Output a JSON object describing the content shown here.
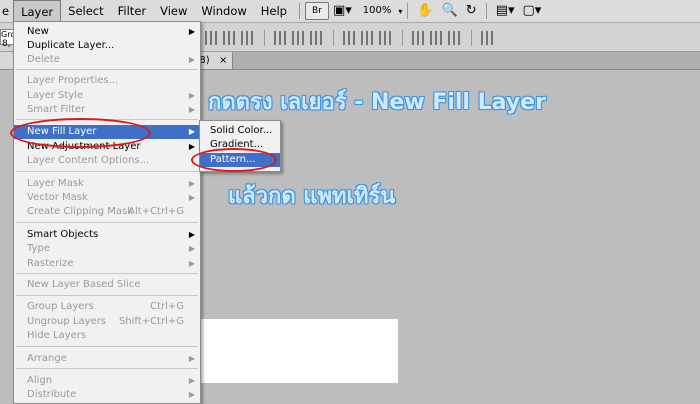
{
  "menubar": {
    "items": [
      "Layer",
      "Select",
      "Filter",
      "View",
      "Window",
      "Help"
    ],
    "br_label": "Br",
    "zoom": "100%",
    "left_clip": "e"
  },
  "options_bar": {
    "field_text": "Groo"
  },
  "document_tab": {
    "left_text": "8, 1",
    "suffix": "/8)",
    "close": "×"
  },
  "layer_menu": {
    "items": [
      {
        "label": "New",
        "submenu": true,
        "enabled": true
      },
      {
        "label": "Duplicate Layer...",
        "enabled": true
      },
      {
        "label": "Delete",
        "submenu": true,
        "enabled": false
      },
      {
        "label": "Layer Properties...",
        "enabled": false
      },
      {
        "label": "Layer Style",
        "submenu": true,
        "enabled": false
      },
      {
        "label": "Smart Filter",
        "submenu": true,
        "enabled": false
      },
      {
        "label": "New Fill Layer",
        "submenu": true,
        "enabled": true,
        "highlighted": true
      },
      {
        "label": "New Adjustment Layer",
        "submenu": true,
        "enabled": true
      },
      {
        "label": "Layer Content Options...",
        "enabled": false
      },
      {
        "label": "Layer Mask",
        "submenu": true,
        "enabled": false
      },
      {
        "label": "Vector Mask",
        "submenu": true,
        "enabled": false
      },
      {
        "label": "Create Clipping Mask",
        "shortcut": "Alt+Ctrl+G",
        "enabled": false
      },
      {
        "label": "Smart Objects",
        "submenu": true,
        "enabled": true
      },
      {
        "label": "Type",
        "submenu": true,
        "enabled": false
      },
      {
        "label": "Rasterize",
        "submenu": true,
        "enabled": false
      },
      {
        "label": "New Layer Based Slice",
        "enabled": false
      },
      {
        "label": "Group Layers",
        "shortcut": "Ctrl+G",
        "enabled": false
      },
      {
        "label": "Ungroup Layers",
        "shortcut": "Shift+Ctrl+G",
        "enabled": false
      },
      {
        "label": "Hide Layers",
        "enabled": false
      },
      {
        "label": "Arrange",
        "submenu": true,
        "enabled": false
      },
      {
        "label": "Align",
        "submenu": true,
        "enabled": false
      },
      {
        "label": "Distribute",
        "submenu": true,
        "enabled": false
      }
    ]
  },
  "fill_submenu": {
    "items": [
      "Solid Color...",
      "Gradient...",
      "Pattern..."
    ],
    "highlighted": "Pattern..."
  },
  "annotations": {
    "line1": "กดตรง เลเยอร์ - New Fill Layer",
    "line2": "แล้วกด แพทเทิร์น",
    "color": "#cfe9ff"
  },
  "colors": {
    "highlight": "#3f6fc6",
    "circle": "#e01818",
    "canvas": "#bdbdbd"
  }
}
